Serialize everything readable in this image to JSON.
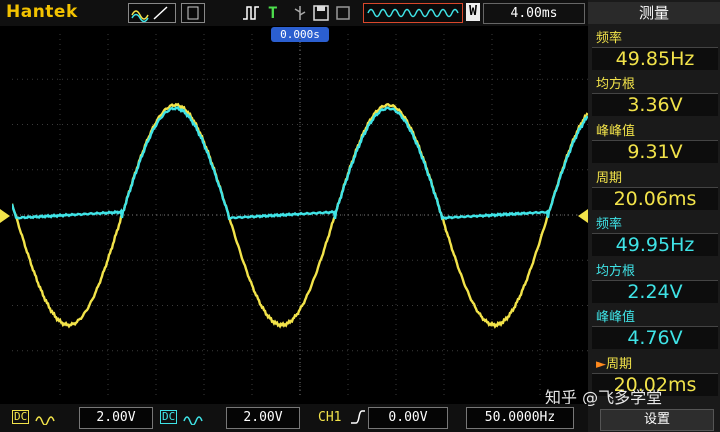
{
  "topbar": {
    "brand": "Hantek",
    "trigger_mode": "T",
    "mode_letter": "W",
    "timebase": "4.00ms",
    "trigger_position": "0.000s"
  },
  "measure_panel": {
    "title": "测量",
    "items": [
      {
        "label": "频率",
        "value": "49.85Hz",
        "color": "yellow"
      },
      {
        "label": "均方根",
        "value": "3.36V",
        "color": "yellow"
      },
      {
        "label": "峰峰值",
        "value": "9.31V",
        "color": "yellow"
      },
      {
        "label": "周期",
        "value": "20.06ms",
        "color": "yellow"
      },
      {
        "label": "频率",
        "value": "49.95Hz",
        "color": "cyan"
      },
      {
        "label": "均方根",
        "value": "2.24V",
        "color": "cyan"
      },
      {
        "label": "峰峰值",
        "value": "4.76V",
        "color": "cyan"
      },
      {
        "label": "周期",
        "value": "20.02ms",
        "color": "yellow"
      }
    ],
    "settings_button": "设置"
  },
  "bottombar": {
    "ch1_coupling": "DC",
    "ch1_scale": "2.00V",
    "ch2_coupling": "DC",
    "ch2_scale": "2.00V",
    "trigger_source": "CH1",
    "trigger_level": "0.00V",
    "trigger_freq": "50.0000Hz"
  },
  "watermark": "知乎 @飞多学堂",
  "colors": {
    "ch1": "#f2e34a",
    "ch2": "#3fe3e6",
    "brand": "#f2c200",
    "trigger_marker": "#ff8a1e"
  }
}
